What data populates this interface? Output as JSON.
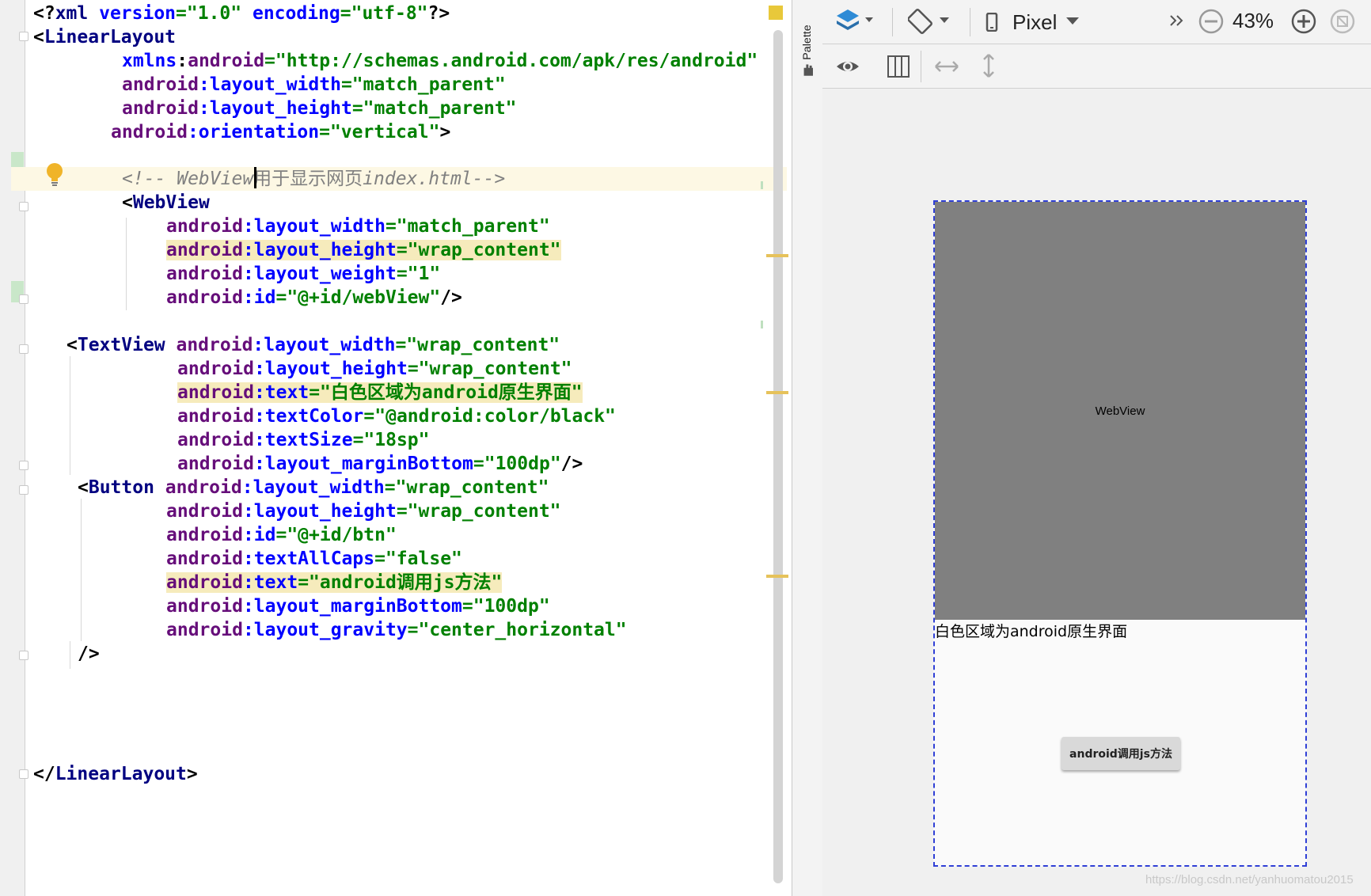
{
  "editor": {
    "code": {
      "l1_a": "<?",
      "l1_b": "xml ",
      "l1_c": "version",
      "l1_d": "=\"1.0\" ",
      "l1_e": "encoding",
      "l1_f": "=\"utf-8\"",
      "l1_g": "?>",
      "l2_open": "<",
      "l2_tag": "LinearLayout",
      "l3_ns": "xmlns",
      "l3_colon": ":",
      "l3_attr": "android",
      "l3_val": "=\"http://schemas.android.com/apk/res/android\"",
      "l4_ns": "android",
      "l4_attr": ":layout_width",
      "l4_val": "=\"match_parent\"",
      "l5_ns": "android",
      "l5_attr": ":layout_height",
      "l5_val": "=\"match_parent\"",
      "l6_ns": "android",
      "l6_attr": ":orientation",
      "l6_val": "=\"vertical\"",
      "l6_close": ">",
      "c1": "<!-- WebView",
      "c2": "用于显示网页",
      "c3": "index.html-->",
      "wv_open": "<",
      "wv_tag": "WebView",
      "wv1_ns": "android",
      "wv1_attr": ":layout_width",
      "wv1_val": "=\"match_parent\"",
      "wv2_ns": "android",
      "wv2_attr": ":layout_height",
      "wv2_val": "=\"wrap_content\"",
      "wv3_ns": "android",
      "wv3_attr": ":layout_weight",
      "wv3_val": "=\"1\"",
      "wv4_ns": "android",
      "wv4_attr": ":id",
      "wv4_val": "=\"@+id/webView\"",
      "wv4_close": "/>",
      "tv_open": "<",
      "tv_tag": "TextView ",
      "tv0_ns": "android",
      "tv0_attr": ":layout_width",
      "tv0_val": "=\"wrap_content\"",
      "tv1_ns": "android",
      "tv1_attr": ":layout_height",
      "tv1_val": "=\"wrap_content\"",
      "tv2_ns": "android",
      "tv2_attr": ":text",
      "tv2_val": "=\"白色区域为android原生界面\"",
      "tv3_ns": "android",
      "tv3_attr": ":textColor",
      "tv3_val": "=\"@android:color/black\"",
      "tv4_ns": "android",
      "tv4_attr": ":textSize",
      "tv4_val": "=\"18sp\"",
      "tv5_ns": "android",
      "tv5_attr": ":layout_marginBottom",
      "tv5_val": "=\"100dp\"",
      "tv5_close": "/>",
      "bt_open": "<",
      "bt_tag": "Button ",
      "bt0_ns": "android",
      "bt0_attr": ":layout_width",
      "bt0_val": "=\"wrap_content\"",
      "bt1_ns": "android",
      "bt1_attr": ":layout_height",
      "bt1_val": "=\"wrap_content\"",
      "bt2_ns": "android",
      "bt2_attr": ":id",
      "bt2_val": "=\"@+id/btn\"",
      "bt3_ns": "android",
      "bt3_attr": ":textAllCaps",
      "bt3_val": "=\"false\"",
      "bt4_ns": "android",
      "bt4_attr": ":text",
      "bt4_val": "=\"android调用js方法\"",
      "bt5_ns": "android",
      "bt5_attr": ":layout_marginBottom",
      "bt5_val": "=\"100dp\"",
      "bt6_ns": "android",
      "bt6_attr": ":layout_gravity",
      "bt6_val": "=\"center_horizontal\"",
      "bt_close": "/>",
      "end_open": "</",
      "end_tag": "LinearLayout",
      "end_close": ">"
    }
  },
  "palette": {
    "label": "Palette"
  },
  "designer": {
    "toolbar": {
      "device_label": "Pixel",
      "zoom_label": "43%",
      "icons": [
        "layers-icon",
        "orientation-icon",
        "device-icon",
        "more-icon",
        "zoom-out-icon",
        "zoom-in-icon",
        "zoom-fit-icon"
      ]
    },
    "toolbar2": {
      "icons": [
        "eye-icon",
        "blueprint-icon",
        "resize-horizontal-icon",
        "resize-vertical-icon"
      ]
    },
    "preview": {
      "webview_label": "WebView",
      "native_text": "白色区域为android原生界面",
      "button_label": "android调用js方法"
    }
  },
  "watermark": "https://blog.csdn.net/yanhuomatou2015",
  "colors": {
    "tag": "#000080",
    "attribute": "#660e7a",
    "namespace": "#0000ff",
    "value": "#008000",
    "comment": "#808080",
    "highlight": "#f6ebbc",
    "webview_bg": "#808080",
    "selection_border": "#2f3fd6"
  }
}
